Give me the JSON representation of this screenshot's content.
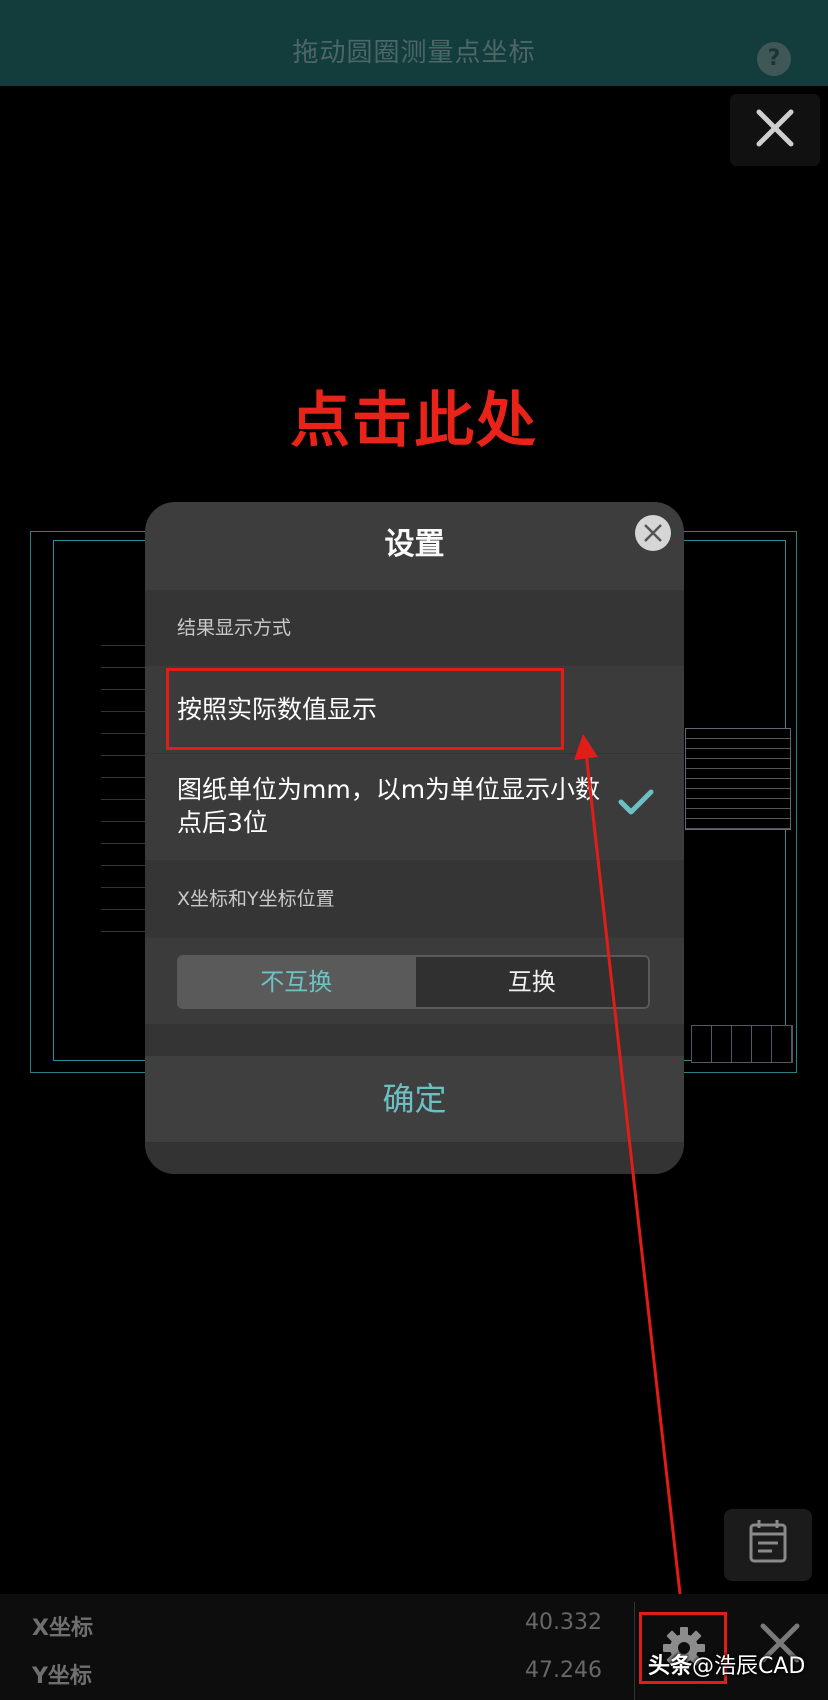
{
  "header": {
    "title": "拖动圆圈测量点坐标",
    "help_icon": "?"
  },
  "annotation": {
    "text": "点击此处",
    "color": "#e8231a"
  },
  "dialog": {
    "title": "设置",
    "section1_label": "结果显示方式",
    "option1_label": "按照实际数值显示",
    "option2_label": "图纸单位为mm，以m为单位显示小数点后3位",
    "option2_selected": true,
    "section2_label": "X坐标和Y坐标位置",
    "segment": {
      "left_label": "不互换",
      "right_label": "互换",
      "selected": "不互换"
    },
    "confirm_label": "确定",
    "accent_color": "#6cc0c3"
  },
  "bottom": {
    "x_label": "X坐标",
    "x_value": "40.332",
    "y_label": "Y坐标",
    "y_value": "47.246"
  },
  "watermark": {
    "brand": "头条",
    "account": "@浩辰CAD"
  }
}
